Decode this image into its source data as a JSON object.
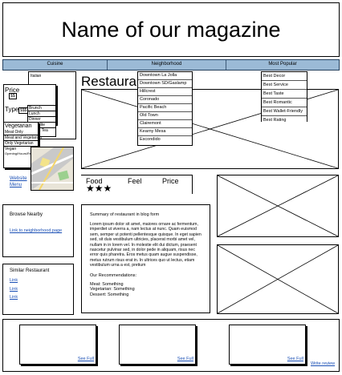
{
  "header": {
    "title": "Name of our magazine"
  },
  "nav": {
    "cuisine": "Cuisine",
    "neighborhood": "Neighborhood",
    "popular": "Most Popular"
  },
  "cuisine_menu": {
    "item0": "Italian",
    "price_label": "Price",
    "type_label": "Type",
    "ss": "$$",
    "sss": "$$$",
    "brunch": "Brunch",
    "lunch": "Lunch",
    "dinner": "Dinner",
    "late_nite": "Late Nite",
    "fast_tea": "Fast & Tea",
    "veg_label": "Vegetarian",
    "meat_only": "Meat Only",
    "meat_and_veg": "Meat and Vegetarian",
    "only_veg": "Only Vegetarian",
    "vegan": "Vegan",
    "vegan_sub": "Opening/Hours/Rss"
  },
  "neighborhood_menu": [
    "Downtown La Jolla",
    "Downtown SD/Gaslamp",
    "Hillcrest",
    "Coronado",
    "Pacific Beach",
    "Old Town",
    "Clairemont",
    "Kearny Mesa",
    "Escondido"
  ],
  "popular_menu": [
    "Best Decor",
    "Best Service",
    "Best Taste",
    "Best Romantic",
    "Best Wallet-Friendly",
    "Best Rating"
  ],
  "restaurant": {
    "heading": "Restaurant",
    "website_link": "Website",
    "menu_link": "Menu",
    "ratings": {
      "food": "Food",
      "feel": "Feel",
      "price": "Price",
      "stars": "★★★"
    }
  },
  "sidebar": {
    "browse_title": "Browse Nearby",
    "browse_link": "Link to neighborhood page",
    "similar_title": "Similar Restaurant",
    "links": [
      "Link",
      "Link",
      "Link"
    ]
  },
  "summary": {
    "title": "Summary of restaurant in blog form",
    "body": "Lorem ipsum dolor sit amet, maiores ornare ac fermentum, imperdiet ut viverra a, nam lectus at nunc. Quam euismod sem, semper ut potenti pellentesque quisque. In eget sapien sed, sit duis vestibulum ultricies, placerat morbi amet vel, nullam in in lorem vel. In molestie elit dui dictum, praesent nascetur pulvinar sed, in dolor pede in aliquam, risus nec error quis pharetra. Eros metus quam augue suspendisse, metus rutrum risus erat in. In ultrices quo ut lectus, etiam vestibulum urna a est, pretium",
    "recs_title": "Our Recommendations:",
    "meat": "Meat: Something",
    "veg": "Vegetarian: Something",
    "dessert": "Dessert: Something"
  },
  "reviews": {
    "see_full": "See Full",
    "write_review": "Write review"
  }
}
